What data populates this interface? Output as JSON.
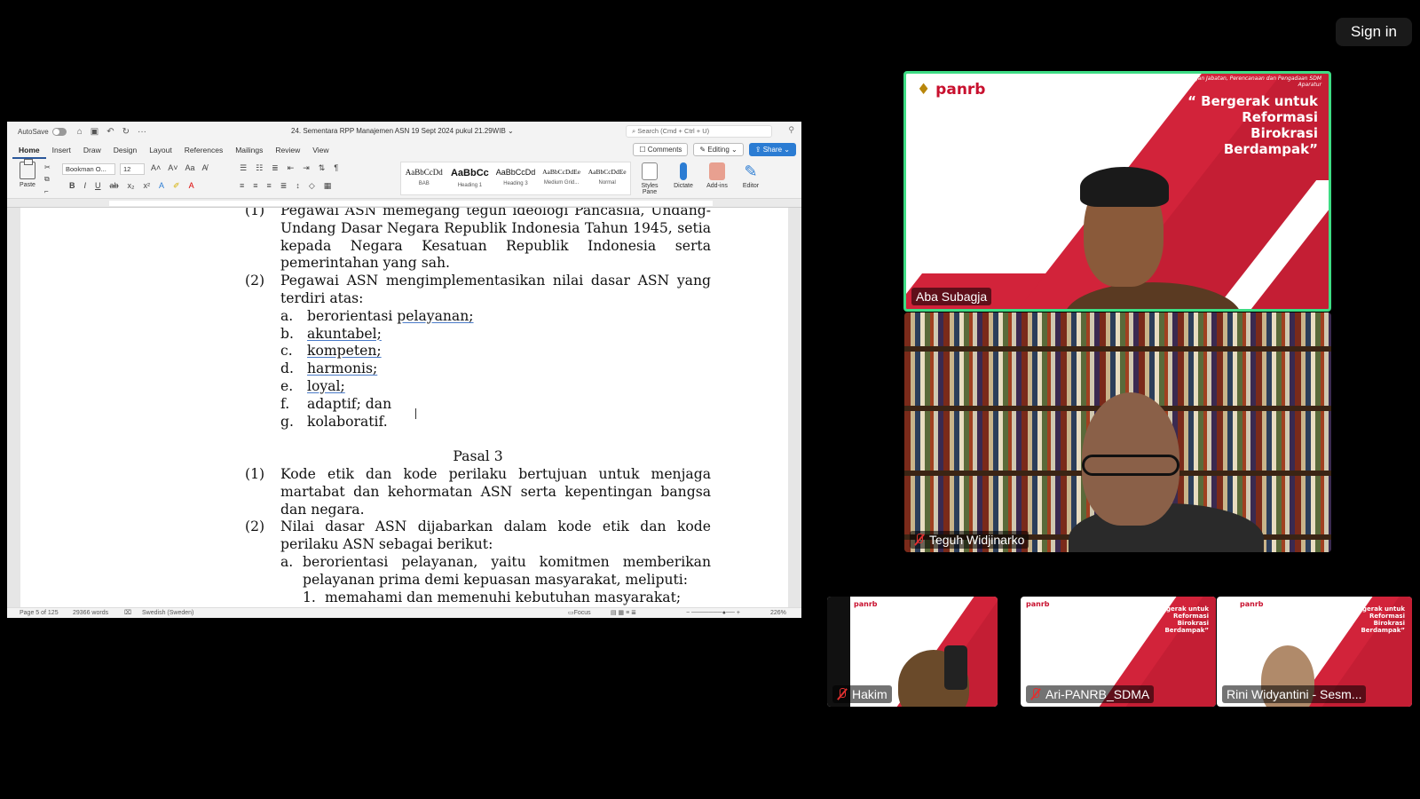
{
  "sign_in": "Sign in",
  "word": {
    "autosave": "AutoSave",
    "doc_title": "24. Sementara RPP Manajemen ASN 19 Sept 2024 pukul 21.29WIB",
    "search_placeholder": "Search (Cmd + Ctrl + U)",
    "tabs": [
      "Home",
      "Insert",
      "Draw",
      "Design",
      "Layout",
      "References",
      "Mailings",
      "Review",
      "View"
    ],
    "comments": "Comments",
    "editing": "Editing",
    "share": "Share",
    "paste": "Paste",
    "font_name": "Bookman O...",
    "font_size": "12",
    "styles": [
      {
        "sample": "AaBbCcDd",
        "name": "BAB"
      },
      {
        "sample": "AaBbCc",
        "name": "Heading 1"
      },
      {
        "sample": "AaBbCcDd",
        "name": "Heading 3"
      },
      {
        "sample": "AaBbCcDdEe",
        "name": "Medium Grid..."
      },
      {
        "sample": "AaBbCcDdEe",
        "name": "Normal"
      }
    ],
    "styles_pane": "Styles Pane",
    "dictate": "Dictate",
    "addins": "Add-ins",
    "editor": "Editor",
    "status": {
      "page": "Page 5 of 125",
      "words": "29366 words",
      "language": "Swedish (Sweden)",
      "focus": "Focus",
      "zoom": "226%"
    }
  },
  "document": {
    "p1_num": "(1)",
    "p1_lines": "Pegawai ASN memegang teguh ideologi Pancasila, Undang-Undang Dasar Negara Republik Indonesia Tahun 1945, setia kepada Negara Kesatuan Republik Indonesia serta pemerintahan yang sah.",
    "p2_num": "(2)",
    "p2_text": "Pegawai ASN mengimplementasikan nilai dasar ASN yang terdiri atas:",
    "list": [
      {
        "letter": "a.",
        "pre": "berorientasi ",
        "u": "pelayanan;",
        "post": ""
      },
      {
        "letter": "b.",
        "pre": "",
        "u": "akuntabel;",
        "post": ""
      },
      {
        "letter": "c.",
        "pre": "",
        "u": "kompeten;",
        "post": ""
      },
      {
        "letter": "d.",
        "pre": "",
        "u": "harmonis;",
        "post": ""
      },
      {
        "letter": "e.",
        "pre": "",
        "u": "loyal;",
        "post": ""
      },
      {
        "letter": "f.",
        "pre": "adaptif; dan",
        "u": "",
        "post": ""
      },
      {
        "letter": "g.",
        "pre": "kolaboratif.",
        "u": "",
        "post": ""
      }
    ],
    "pasal": "Pasal 3",
    "q1_num": "(1)",
    "q1_text": "Kode etik dan kode perilaku bertujuan untuk menjaga martabat dan kehormatan ASN serta kepentingan bangsa dan negara.",
    "q2_num": "(2)",
    "q2_text": "Nilai dasar ASN dijabarkan dalam kode etik dan kode perilaku ASN sebagai berikut:",
    "q2a_letter": "a.",
    "q2a_text": "berorientasi pelayanan, yaitu komitmen memberikan pelayanan prima demi kepuasan masyarakat, meliputi:",
    "q2a1_num": "1.",
    "q2a1_text": "memahami dan memenuhi kebutuhan masyarakat;"
  },
  "participants": {
    "main": {
      "name": "Aba Subagja",
      "logo": "panrb",
      "slogan_small": "Asisten Deputi Perancangan Jabatan, Perencanaan dan Pengadaan SDM Aparatur",
      "slogan": [
        "“ Bergerak untuk",
        "Reformasi",
        "Birokrasi",
        "Berdampak”"
      ]
    },
    "second": {
      "name": "Teguh Widjinarko"
    },
    "small": [
      {
        "name": "Hakim"
      },
      {
        "name": "Ari-PANRB_SDMA"
      },
      {
        "name": "Rini Widyantini - Sesm..."
      }
    ],
    "small_slogan": [
      "“Bergerak untuk",
      "Reformasi",
      "Birokrasi",
      "Berdampak”"
    ]
  },
  "colors": {
    "active_speaker_border": "#3ddc84",
    "panrb_red": "#d2233a",
    "word_blue": "#2b579a"
  }
}
